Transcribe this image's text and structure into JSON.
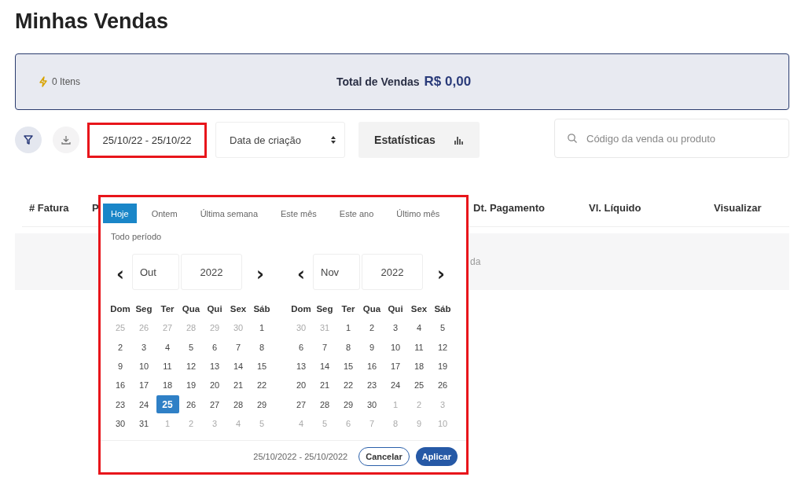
{
  "title": "Minhas Vendas",
  "summary": {
    "items": "0 Itens",
    "total_label": "Total de Vendas",
    "total_value": "R$ 0,00"
  },
  "toolbar": {
    "date_range": {
      "value": "25/10/22 - 25/10/22",
      "highlighted": true
    },
    "sort_select": {
      "value": "Data de criação"
    },
    "stats_button": "Estatísticas",
    "search": {
      "placeholder": "Código da venda ou produto"
    }
  },
  "table": {
    "columns": [
      "# Fatura",
      "P",
      "Dt. Pagamento",
      "Vl. Líquido",
      "Visualizar"
    ],
    "empty_message": "da"
  },
  "date_picker": {
    "highlighted": true,
    "ranges": [
      {
        "label": "Hoje",
        "selected": true
      },
      {
        "label": "Ontem",
        "selected": false
      },
      {
        "label": "Última semana",
        "selected": false
      },
      {
        "label": "Este mês",
        "selected": false
      },
      {
        "label": "Este ano",
        "selected": false
      },
      {
        "label": "Último mês",
        "selected": false
      },
      {
        "label": "Todo período",
        "selected": false
      }
    ],
    "prev": "‹",
    "next": "›",
    "months": [
      {
        "month": "Out",
        "year": "2022",
        "weekdays": [
          "Dom",
          "Seg",
          "Ter",
          "Qua",
          "Qui",
          "Sex",
          "Sáb"
        ],
        "weeks": [
          [
            {
              "day": "25",
              "muted": true,
              "selected": false
            },
            {
              "day": "26",
              "muted": true,
              "selected": false
            },
            {
              "day": "27",
              "muted": true,
              "selected": false
            },
            {
              "day": "28",
              "muted": true,
              "selected": false
            },
            {
              "day": "29",
              "muted": true,
              "selected": false
            },
            {
              "day": "30",
              "muted": true,
              "selected": false
            },
            {
              "day": "1",
              "muted": false,
              "selected": false
            }
          ],
          [
            {
              "day": "2",
              "muted": false,
              "selected": false
            },
            {
              "day": "3",
              "muted": false,
              "selected": false
            },
            {
              "day": "4",
              "muted": false,
              "selected": false
            },
            {
              "day": "5",
              "muted": false,
              "selected": false
            },
            {
              "day": "6",
              "muted": false,
              "selected": false
            },
            {
              "day": "7",
              "muted": false,
              "selected": false
            },
            {
              "day": "8",
              "muted": false,
              "selected": false
            }
          ],
          [
            {
              "day": "9",
              "muted": false,
              "selected": false
            },
            {
              "day": "10",
              "muted": false,
              "selected": false
            },
            {
              "day": "11",
              "muted": false,
              "selected": false
            },
            {
              "day": "12",
              "muted": false,
              "selected": false
            },
            {
              "day": "13",
              "muted": false,
              "selected": false
            },
            {
              "day": "14",
              "muted": false,
              "selected": false
            },
            {
              "day": "15",
              "muted": false,
              "selected": false
            }
          ],
          [
            {
              "day": "16",
              "muted": false,
              "selected": false
            },
            {
              "day": "17",
              "muted": false,
              "selected": false
            },
            {
              "day": "18",
              "muted": false,
              "selected": false
            },
            {
              "day": "19",
              "muted": false,
              "selected": false
            },
            {
              "day": "20",
              "muted": false,
              "selected": false
            },
            {
              "day": "21",
              "muted": false,
              "selected": false
            },
            {
              "day": "22",
              "muted": false,
              "selected": false
            }
          ],
          [
            {
              "day": "23",
              "muted": false,
              "selected": false
            },
            {
              "day": "24",
              "muted": false,
              "selected": false
            },
            {
              "day": "25",
              "muted": false,
              "selected": true
            },
            {
              "day": "26",
              "muted": false,
              "selected": false
            },
            {
              "day": "27",
              "muted": false,
              "selected": false
            },
            {
              "day": "28",
              "muted": false,
              "selected": false
            },
            {
              "day": "29",
              "muted": false,
              "selected": false
            }
          ],
          [
            {
              "day": "30",
              "muted": false,
              "selected": false
            },
            {
              "day": "31",
              "muted": false,
              "selected": false
            },
            {
              "day": "1",
              "muted": true,
              "selected": false
            },
            {
              "day": "2",
              "muted": true,
              "selected": false
            },
            {
              "day": "3",
              "muted": true,
              "selected": false
            },
            {
              "day": "4",
              "muted": true,
              "selected": false
            },
            {
              "day": "5",
              "muted": true,
              "selected": false
            }
          ]
        ]
      },
      {
        "month": "Nov",
        "year": "2022",
        "weekdays": [
          "Dom",
          "Seg",
          "Ter",
          "Qua",
          "Qui",
          "Sex",
          "Sáb"
        ],
        "weeks": [
          [
            {
              "day": "30",
              "muted": true,
              "selected": false
            },
            {
              "day": "31",
              "muted": true,
              "selected": false
            },
            {
              "day": "1",
              "muted": false,
              "selected": false
            },
            {
              "day": "2",
              "muted": false,
              "selected": false
            },
            {
              "day": "3",
              "muted": false,
              "selected": false
            },
            {
              "day": "4",
              "muted": false,
              "selected": false
            },
            {
              "day": "5",
              "muted": false,
              "selected": false
            }
          ],
          [
            {
              "day": "6",
              "muted": false,
              "selected": false
            },
            {
              "day": "7",
              "muted": false,
              "selected": false
            },
            {
              "day": "8",
              "muted": false,
              "selected": false
            },
            {
              "day": "9",
              "muted": false,
              "selected": false
            },
            {
              "day": "10",
              "muted": false,
              "selected": false
            },
            {
              "day": "11",
              "muted": false,
              "selected": false
            },
            {
              "day": "12",
              "muted": false,
              "selected": false
            }
          ],
          [
            {
              "day": "13",
              "muted": false,
              "selected": false
            },
            {
              "day": "14",
              "muted": false,
              "selected": false
            },
            {
              "day": "15",
              "muted": false,
              "selected": false
            },
            {
              "day": "16",
              "muted": false,
              "selected": false
            },
            {
              "day": "17",
              "muted": false,
              "selected": false
            },
            {
              "day": "18",
              "muted": false,
              "selected": false
            },
            {
              "day": "19",
              "muted": false,
              "selected": false
            }
          ],
          [
            {
              "day": "20",
              "muted": false,
              "selected": false
            },
            {
              "day": "21",
              "muted": false,
              "selected": false
            },
            {
              "day": "22",
              "muted": false,
              "selected": false
            },
            {
              "day": "23",
              "muted": false,
              "selected": false
            },
            {
              "day": "24",
              "muted": false,
              "selected": false
            },
            {
              "day": "25",
              "muted": false,
              "selected": false
            },
            {
              "day": "26",
              "muted": false,
              "selected": false
            }
          ],
          [
            {
              "day": "27",
              "muted": false,
              "selected": false
            },
            {
              "day": "28",
              "muted": false,
              "selected": false
            },
            {
              "day": "29",
              "muted": false,
              "selected": false
            },
            {
              "day": "30",
              "muted": false,
              "selected": false
            },
            {
              "day": "1",
              "muted": true,
              "selected": false
            },
            {
              "day": "2",
              "muted": true,
              "selected": false
            },
            {
              "day": "3",
              "muted": true,
              "selected": false
            }
          ],
          [
            {
              "day": "4",
              "muted": true,
              "selected": false
            },
            {
              "day": "5",
              "muted": true,
              "selected": false
            },
            {
              "day": "6",
              "muted": true,
              "selected": false
            },
            {
              "day": "7",
              "muted": true,
              "selected": false
            },
            {
              "day": "8",
              "muted": true,
              "selected": false
            },
            {
              "day": "9",
              "muted": true,
              "selected": false
            },
            {
              "day": "10",
              "muted": true,
              "selected": false
            }
          ]
        ]
      }
    ],
    "footer": {
      "range": "25/10/2022 - 25/10/2022",
      "cancel": "Cancelar",
      "apply": "Aplicar"
    }
  }
}
